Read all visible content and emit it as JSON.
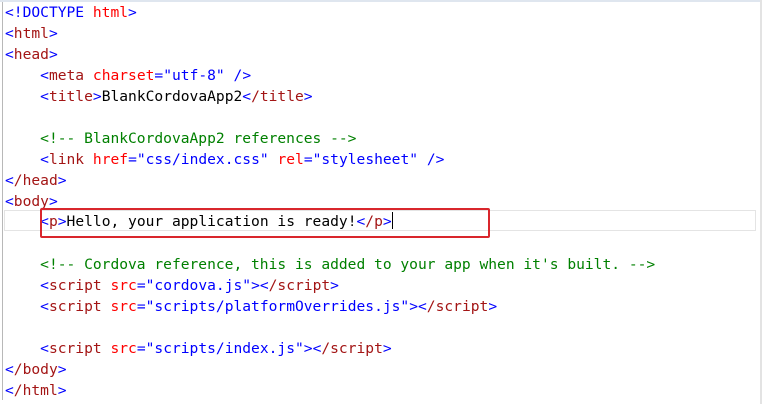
{
  "colors": {
    "bracket": "#0000ff",
    "tag": "#a31515",
    "attribute": "#ff0000",
    "string": "#0000ff",
    "comment": "#008000",
    "highlight_box": "#d9262c"
  },
  "code": {
    "doctype": {
      "keyword": "!DOCTYPE",
      "value": "html"
    },
    "html_open": "html",
    "head_open": "head",
    "meta": {
      "tag": "meta",
      "attr": "charset",
      "value": "\"utf-8\""
    },
    "title": {
      "tag": "title",
      "text": "BlankCordovaApp2",
      "close": "/title"
    },
    "comment_refs": "<!-- BlankCordovaApp2 references -->",
    "link": {
      "tag": "link",
      "attr1": "href",
      "value1": "\"css/index.css\"",
      "attr2": "rel",
      "value2": "\"stylesheet\""
    },
    "head_close": "/head",
    "body_open": "body",
    "p": {
      "tag": "p",
      "text": "Hello, your application is ready!",
      "close": "/p"
    },
    "comment_cordova": "<!-- Cordova reference, this is added to your app when it's built. -->",
    "script1": {
      "tag": "script",
      "attr": "src",
      "value": "\"cordova.js\"",
      "close": "/script"
    },
    "script2": {
      "tag": "script",
      "attr": "src",
      "value": "\"scripts/platformOverrides.js\"",
      "close": "/script"
    },
    "script3": {
      "tag": "script",
      "attr": "src",
      "value": "\"scripts/index.js\"",
      "close": "/script"
    },
    "body_close": "/body",
    "html_close": "/html"
  }
}
